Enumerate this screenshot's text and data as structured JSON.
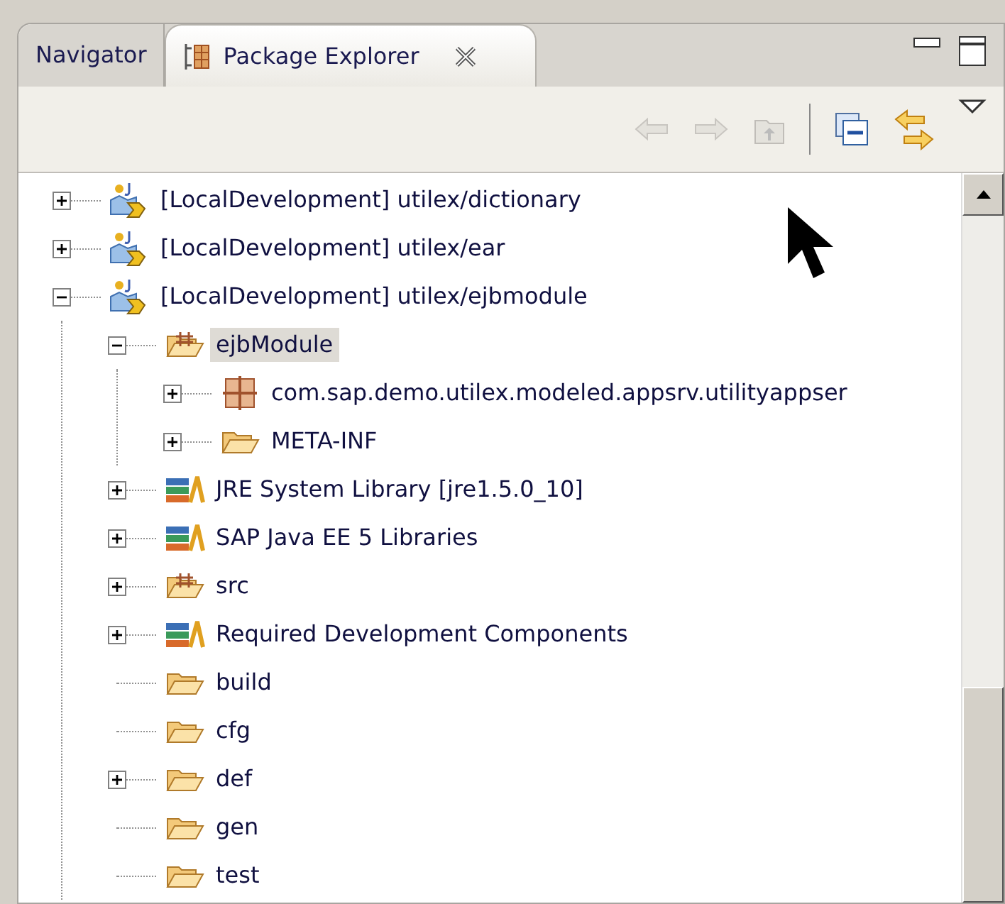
{
  "tabs": [
    {
      "label": "Navigator",
      "selected": false
    },
    {
      "label": "Package Explorer",
      "selected": true
    }
  ],
  "tree": [
    {
      "kind": "project",
      "label": "[LocalDevelopment] utilex/dictionary",
      "expanded": false
    },
    {
      "kind": "project",
      "label": "[LocalDevelopment] utilex/ear",
      "expanded": false
    },
    {
      "kind": "project",
      "label": "[LocalDevelopment] utilex/ejbmodule",
      "expanded": true,
      "children": [
        {
          "kind": "source-folder",
          "label": "ejbModule",
          "expanded": true,
          "selected": true,
          "children": [
            {
              "kind": "package",
              "label": "com.sap.demo.utilex.modeled.appsrv.utilityappser",
              "expanded": false
            },
            {
              "kind": "folder",
              "label": "META-INF",
              "expanded": false
            }
          ]
        },
        {
          "kind": "library",
          "label": "JRE System Library [jre1.5.0_10]",
          "expanded": false
        },
        {
          "kind": "library",
          "label": "SAP Java EE 5 Libraries",
          "expanded": false
        },
        {
          "kind": "source-folder",
          "label": "src",
          "expanded": false
        },
        {
          "kind": "library",
          "label": "Required Development Components",
          "expanded": false
        },
        {
          "kind": "folder",
          "label": "build"
        },
        {
          "kind": "folder",
          "label": "cfg"
        },
        {
          "kind": "folder",
          "label": "def",
          "expanded": false
        },
        {
          "kind": "folder",
          "label": "gen"
        },
        {
          "kind": "folder",
          "label": "test"
        }
      ]
    }
  ]
}
